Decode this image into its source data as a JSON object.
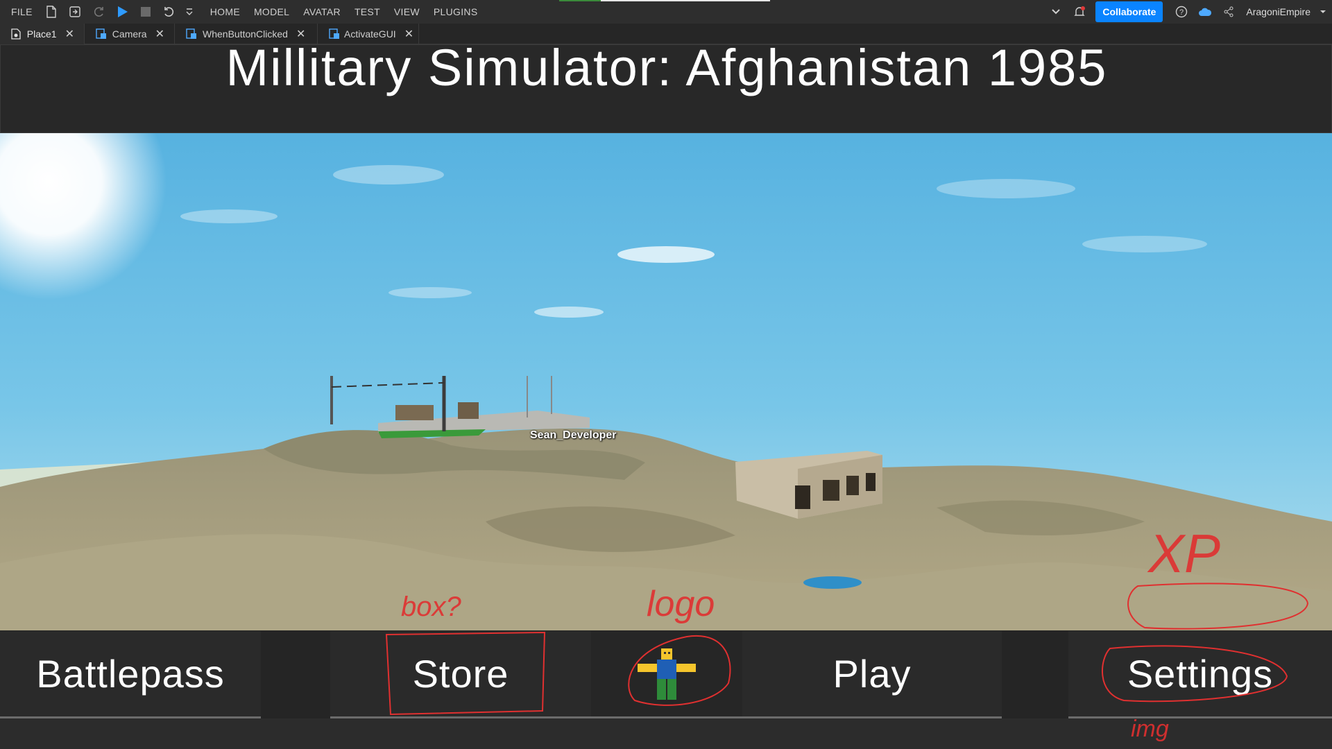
{
  "menu": {
    "file": "FILE",
    "tabs": [
      "HOME",
      "MODEL",
      "AVATAR",
      "TEST",
      "VIEW",
      "PLUGINS"
    ],
    "collaborate": "Collaborate",
    "username": "AragoniEmpire"
  },
  "editor_tabs": [
    {
      "label": "Place1",
      "icon": "place-file-icon"
    },
    {
      "label": "Camera",
      "icon": "script-icon"
    },
    {
      "label": "WhenButtonClicked",
      "icon": "script-icon"
    },
    {
      "label": "ActivateGUI",
      "icon": "script-icon"
    }
  ],
  "game": {
    "title": "Millitary Simulator: Afghanistan 1985",
    "player_name": "Sean_Developer",
    "buttons": {
      "battlepass": "Battlepass",
      "store": "Store",
      "play": "Play",
      "settings": "Settings"
    },
    "avatar_icon": "roblox-character-icon"
  },
  "annotations": {
    "box": "box?",
    "logo": "logo",
    "xp": "XP",
    "img": "img"
  },
  "colors": {
    "accent": "#0a84ff",
    "annotation": "#e03030",
    "sky": "#5fb8e0",
    "sand": "#a89f80"
  }
}
